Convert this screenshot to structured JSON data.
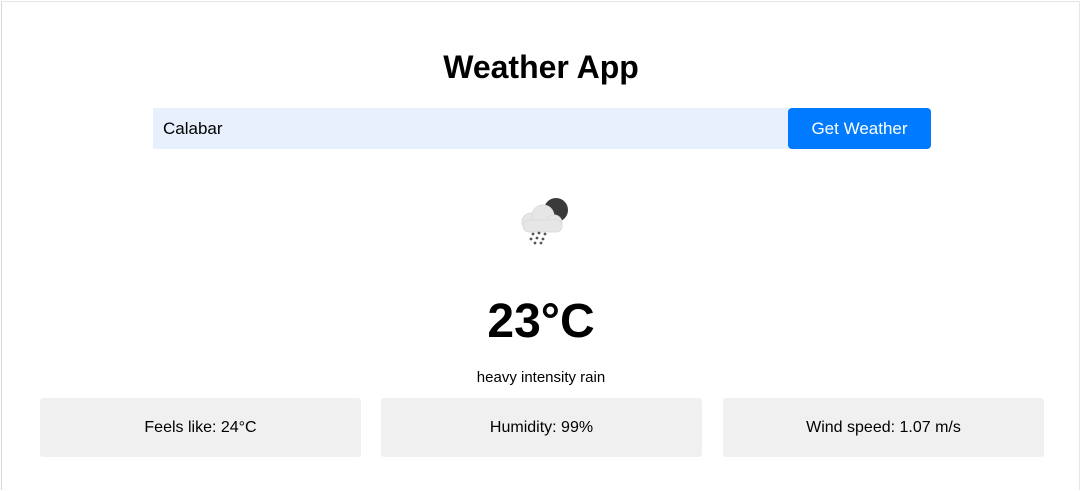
{
  "app": {
    "title": "Weather App"
  },
  "search": {
    "value": "Calabar",
    "button_label": "Get Weather"
  },
  "weather": {
    "icon": "night-rain-cloud-icon",
    "temperature": "23°C",
    "description": "heavy intensity rain"
  },
  "details": {
    "feels_like": "Feels like: 24°C",
    "humidity": "Humidity: 99%",
    "wind_speed": "Wind speed: 1.07 m/s"
  },
  "colors": {
    "button": "#007bff",
    "input_background": "#e8f0fe",
    "card_background": "#f0f0f0"
  }
}
